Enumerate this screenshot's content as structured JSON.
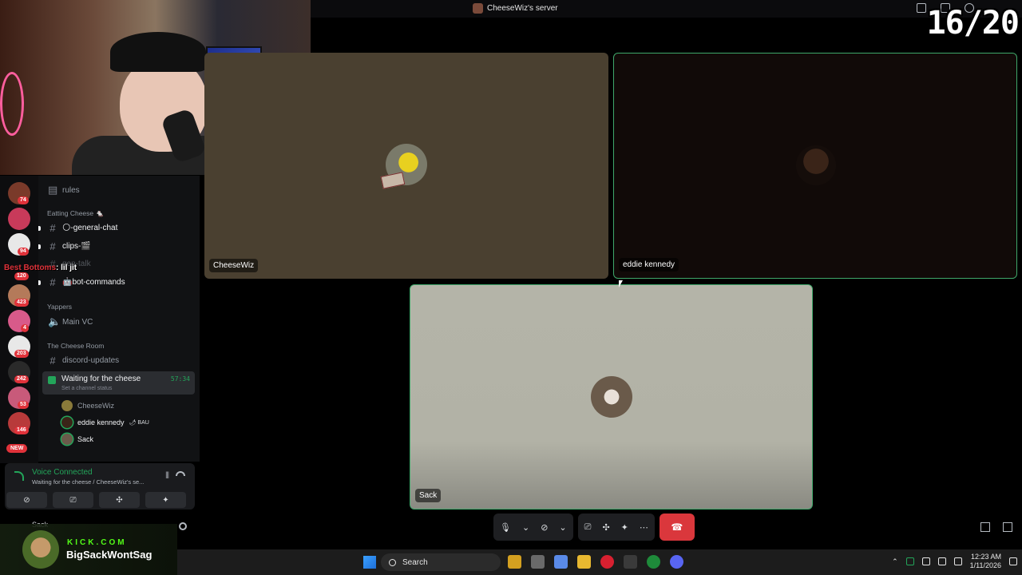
{
  "titlebar": {
    "server_name": "CheeseWiz's server"
  },
  "overlay": {
    "counter": "16/20",
    "chat_user": "Best Bottoms",
    "chat_message": ": lil jit"
  },
  "rail": {
    "badges": [
      "74",
      "94",
      "120",
      "423",
      "4",
      "203",
      "242",
      "53",
      "146"
    ],
    "new_label": "NEW"
  },
  "sidebar": {
    "rules": "rules",
    "categories": {
      "eatting_cheese": "Eatting Cheese 🐁",
      "yappers": "Yappers",
      "cheese_room": "The Cheese Room"
    },
    "channels": {
      "general_chat": "🌕-general-chat",
      "clips": "clips-🎬",
      "gen_talk": "gen-talk",
      "bot_commands": "🤖bot-commands",
      "main_vc": "Main VC",
      "discord_updates": "discord-updates"
    },
    "active_voice": {
      "name": "Waiting for the cheese",
      "status": "Set a channel status",
      "timer": "57:34"
    },
    "members": [
      {
        "name": "CheeseWiz"
      },
      {
        "name": "eddie kennedy",
        "tag": "🌶 BAU"
      },
      {
        "name": "Sack"
      }
    ]
  },
  "voice_panel": {
    "title": "Voice Connected",
    "subtitle": "Waiting for the cheese / CheeseWiz's se..."
  },
  "userbar": {
    "username": "Sack"
  },
  "tiles": [
    {
      "label": "CheeseWiz"
    },
    {
      "label": "eddie kennedy"
    },
    {
      "label": "Sack"
    }
  ],
  "kick": {
    "site": "KICK.COM",
    "handle": "BigSackWontSag"
  },
  "taskbar": {
    "search_placeholder": "Search",
    "time": "12:23 AM",
    "date": "1/11/2026"
  },
  "colors": {
    "accent_green": "#23a55a",
    "end_call": "#da373c",
    "kick_green": "#53fc18"
  }
}
